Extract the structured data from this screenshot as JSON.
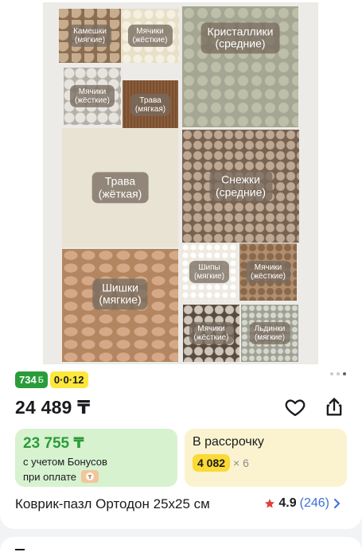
{
  "product": {
    "image_labels": {
      "kameshki": "Камешки\n(мягкие)",
      "myachiki_1": "Мячики\n(жёсткие)",
      "kristalliki": "Кристаллики\n(средние)",
      "myachiki_2": "Мячики\n(жёсткие)",
      "trava_1": "Трава\n(мягкая)",
      "trava_2": "Трава\n(жёткая)",
      "snezhki": "Снежки\n(средние)",
      "shishki": "Шишки\n(мягкие)",
      "shipy": "Шипы\n(мягкие)",
      "myachiki_3": "Мячики\n(жёсткие)",
      "myachiki_4": "Мячики\n(жёсткие)",
      "ldinki": "Льдинки\n(мягкие)"
    },
    "gallery": {
      "total_dots": 3,
      "active_index": 2
    },
    "badges": [
      {
        "text": "734",
        "sub": "Б",
        "color": "#2a9d3a"
      },
      {
        "text": "0·0·12",
        "color": "#fde73a"
      }
    ],
    "price": "24 489 ₸",
    "bonus": {
      "price": "23 755 ₸",
      "line1": "с учетом Бонусов",
      "line2": "при оплате"
    },
    "installment": {
      "title": "В рассрочку",
      "amount": "4 082",
      "multiplier": "× 6"
    },
    "title": "Коврик-пазл Ортодон 25х25 см",
    "rating": {
      "value": "4.9",
      "count": "(246)"
    }
  },
  "icons": {
    "favorite": "heart-icon",
    "share": "share-icon",
    "star": "star-icon",
    "chevron": "chevron-right-icon",
    "payment": "wallet-icon"
  },
  "colors": {
    "bonus_green": "#2b9c39",
    "accent_yellow": "#fbd936",
    "link_blue": "#3d6fd6",
    "star_red": "#e0413a"
  }
}
